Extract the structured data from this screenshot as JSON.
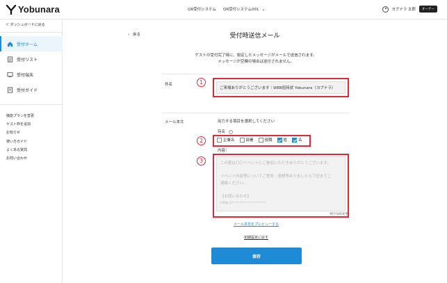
{
  "header": {
    "logo_text": "Yobunara",
    "nav": [
      "QR受付システム",
      "QR受付システム001"
    ],
    "user_name": "ヨブナラ 太郎",
    "role_badge": "オーナー"
  },
  "sidebar": {
    "back_label": "＜ ダッシュボードに戻る",
    "items": [
      {
        "label": "受付ホーム",
        "icon": "home-icon",
        "active": true
      },
      {
        "label": "受付リスト",
        "icon": "list-icon",
        "active": false
      },
      {
        "label": "受付端末",
        "icon": "device-icon",
        "active": false
      },
      {
        "label": "受付ガイド",
        "icon": "guide-icon",
        "active": false
      }
    ],
    "links": [
      "機能プランを変更",
      "ゲスト枠を追加",
      "お知らせ",
      "使い方ガイド",
      "よくある質問",
      "お問い合わせ"
    ]
  },
  "main": {
    "back_label": "戻る",
    "title": "受付時送信メール",
    "intro_line1": "ゲストの受付完了時に、設定したメッセージがメールで送信されます。",
    "intro_line2": "メッセージが空欄の場合は送付されません。",
    "subject_label": "件名",
    "subject_value": "ご来場ありがとうございます｜WEB招待状 Yobunara（ヨブナラ）",
    "body_label": "メール本文",
    "output_label": "出力する項目を選択してください",
    "addressee_label": "宛名",
    "checkboxes": [
      {
        "label": "企業名",
        "checked": false
      },
      {
        "label": "部署",
        "checked": false
      },
      {
        "label": "役職",
        "checked": false
      },
      {
        "label": "姓",
        "checked": true
      },
      {
        "label": "名",
        "checked": true
      }
    ],
    "content_label": "内容：",
    "body_placeholder_lines": [
      "この度は〇〇イベントにご参加いただきありがとうございます。",
      "",
      "イベント内容等についてご意見・感想等ありましたら下記までご",
      "連絡ください。",
      "",
      "【お問い合わせ】",
      "http://〜〜〜〜〜〜〜〜〜"
    ],
    "counter": "残り500文字",
    "preview_link": "メール本文をプレビューする",
    "reset_link": "初期設定に戻す",
    "save_label": "保存",
    "markers": [
      "1",
      "2",
      "3"
    ]
  },
  "colors": {
    "accent": "#1f8ad6",
    "highlight_border": "#e0283a",
    "active_bg": "#eaf5fc"
  }
}
